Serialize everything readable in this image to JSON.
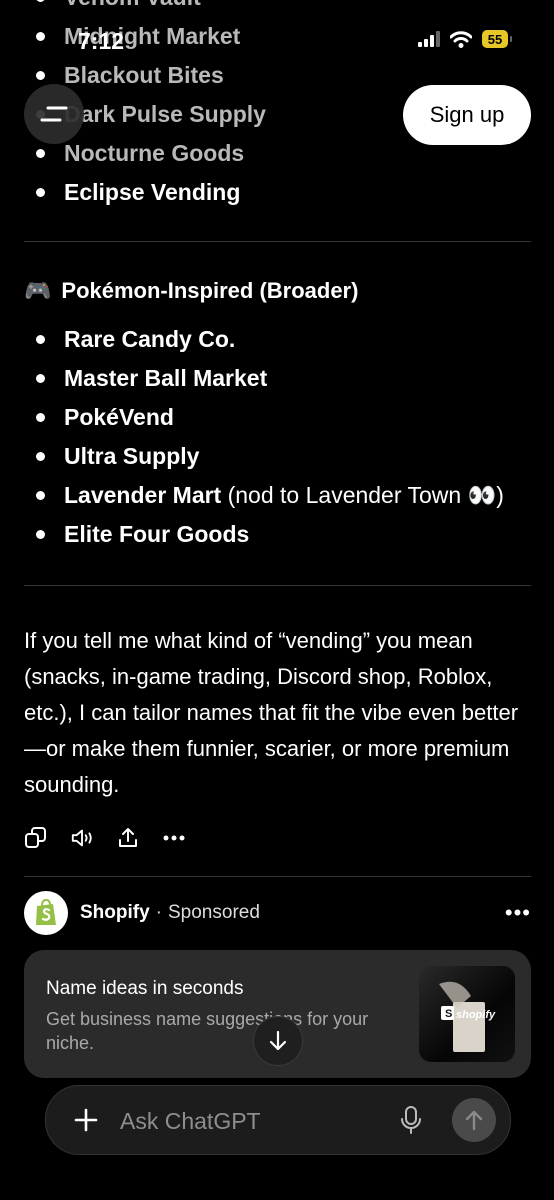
{
  "status_bar": {
    "time": "7:12",
    "battery": "55"
  },
  "header": {
    "signup_label": "Sign up"
  },
  "top_list": [
    "Venom Vault",
    "Midnight Market",
    "Blackout Bites",
    "Dark Pulse Supply",
    "Nocturne Goods",
    "Eclipse Vending"
  ],
  "section": {
    "emoji": "🎮",
    "title": "Pokémon-Inspired (Broader)",
    "items": [
      {
        "bold": "Rare Candy Co.",
        "note": ""
      },
      {
        "bold": "Master Ball Market",
        "note": ""
      },
      {
        "bold": "PokéVend",
        "note": ""
      },
      {
        "bold": "Ultra Supply",
        "note": ""
      },
      {
        "bold": "Lavender Mart",
        "note": " (nod to Lavender Town 👀)"
      },
      {
        "bold": "Elite Four Goods",
        "note": ""
      }
    ]
  },
  "paragraph": "If you tell me what kind of “vending” you mean (snacks, in-game trading, Discord shop, Roblox, etc.), I can tailor names that fit the vibe even better—or make them funnier, scarier, or more premium sounding.",
  "ad": {
    "advertiser": "Shopify",
    "dot": "·",
    "sponsored": "Sponsored",
    "more": "•••",
    "title": "Name ideas in seconds",
    "description": "Get business name suggestions for your niche.",
    "image_brand": "shopify",
    "brand_color": "#95bf47"
  },
  "composer": {
    "placeholder": "Ask ChatGPT"
  }
}
